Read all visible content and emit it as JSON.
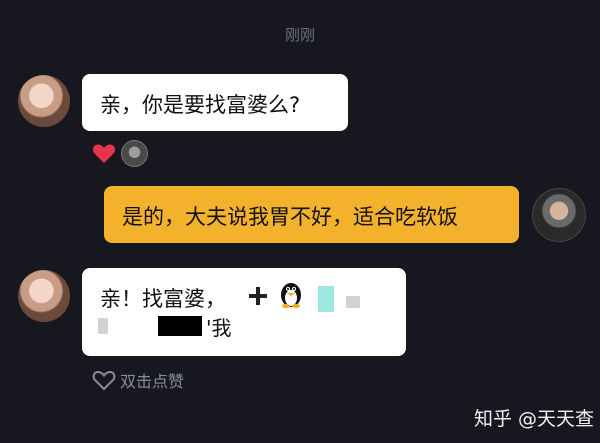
{
  "chat": {
    "timestamp": "刚刚",
    "messages": [
      {
        "sender": "contact",
        "text": "亲，你是要找富婆么?"
      },
      {
        "sender": "me",
        "text": "是的，大夫说我胃不好，适合吃软饭"
      },
      {
        "sender": "contact",
        "line1": "亲！找富婆，",
        "line2": "'我"
      }
    ],
    "like_label": "双击点赞"
  },
  "watermark": "知乎 @天天查",
  "colors": {
    "background": "#16171f",
    "my_bubble": "#f4b12b",
    "their_bubble": "#ffffff",
    "heart": "#e8344a"
  }
}
